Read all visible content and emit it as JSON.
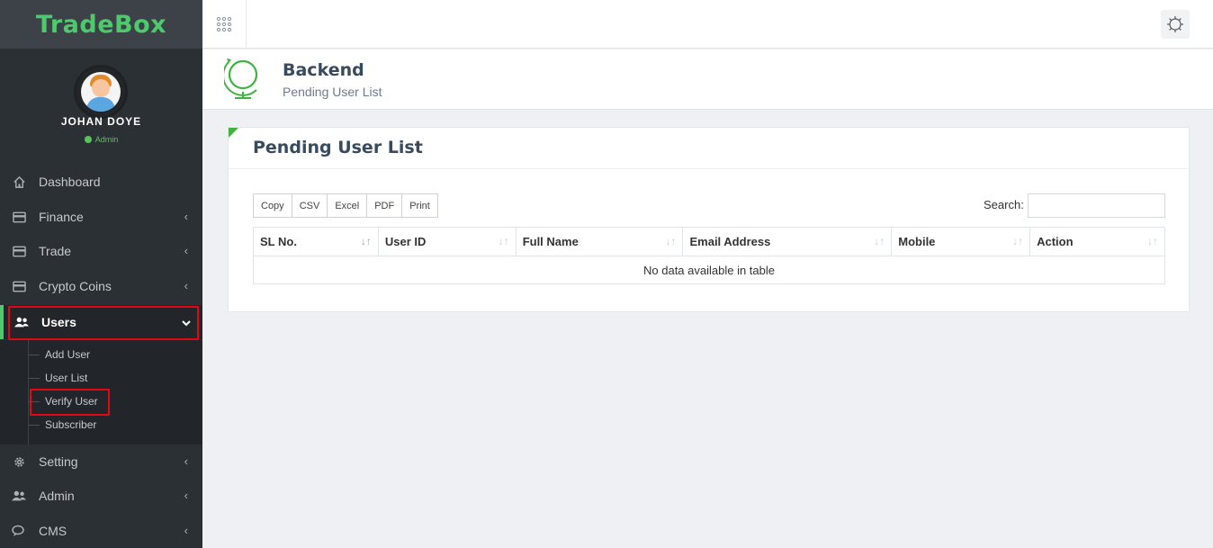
{
  "brand": {
    "name": "TradeBox",
    "color": "#4ec96c"
  },
  "profile": {
    "name": "JOHAN DOYE",
    "role": "Admin",
    "status_color": "#5bc35b"
  },
  "sidebar": {
    "items": [
      {
        "label": "Dashboard",
        "icon": "home-icon"
      },
      {
        "label": "Finance",
        "icon": "card-icon"
      },
      {
        "label": "Trade",
        "icon": "card-icon"
      },
      {
        "label": "Crypto Coins",
        "icon": "card-icon"
      },
      {
        "label": "Users",
        "icon": "users-icon"
      },
      {
        "label": "Setting",
        "icon": "gear-icon"
      },
      {
        "label": "Admin",
        "icon": "users-icon"
      },
      {
        "label": "CMS",
        "icon": "chat-icon"
      }
    ],
    "users_submenu": [
      {
        "label": "Add User"
      },
      {
        "label": "User List"
      },
      {
        "label": "Verify User"
      },
      {
        "label": "Subscriber"
      }
    ]
  },
  "header": {
    "title": "Backend",
    "subtitle": "Pending User List"
  },
  "card": {
    "title": "Pending User List",
    "buttons": [
      "Copy",
      "CSV",
      "Excel",
      "PDF",
      "Print"
    ],
    "search_label": "Search:",
    "search_value": ""
  },
  "table": {
    "columns": [
      "SL No.",
      "User ID",
      "Full Name",
      "Email Address",
      "Mobile",
      "Action"
    ],
    "empty_message": "No data available in table"
  },
  "colors": {
    "accent": "#4ec96c",
    "highlight_box": "#e30613",
    "sidebar_bg": "#2b3035"
  }
}
